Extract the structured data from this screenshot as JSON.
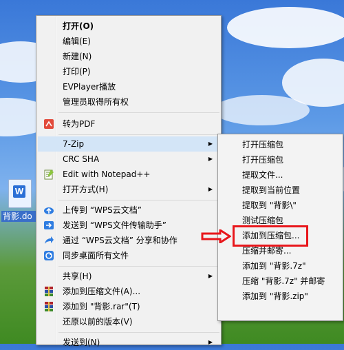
{
  "desktop": {
    "file_icon_label": "背影.do",
    "file_icon_glyph": "W"
  },
  "context_menu": {
    "items": [
      {
        "label": "打开(O)"
      },
      {
        "label": "编辑(E)"
      },
      {
        "label": "新建(N)"
      },
      {
        "label": "打印(P)"
      },
      {
        "label": "EVPlayer播放"
      },
      {
        "label": "管理员取得所有权"
      },
      {
        "label": "转为PDF",
        "icon": "pdf-convert-icon"
      },
      {
        "label": "7-Zip",
        "submenu": true,
        "highlighted": true
      },
      {
        "label": "CRC SHA",
        "submenu": true
      },
      {
        "label": "Edit with Notepad++",
        "icon": "notepad-plus-plus-icon"
      },
      {
        "label": "打开方式(H)",
        "submenu": true
      },
      {
        "label": "上传到 “WPS云文档”",
        "icon": "cloud-upload-icon"
      },
      {
        "label": "发送到 “WPS文件传输助手”",
        "icon": "send-arrow-icon"
      },
      {
        "label": "通过 “WPS云文档” 分享和协作",
        "icon": "share-icon"
      },
      {
        "label": "同步桌面所有文件",
        "icon": "sync-icon"
      },
      {
        "label": "共享(H)",
        "submenu": true
      },
      {
        "label": "添加到压缩文件(A)...",
        "icon": "winrar-icon"
      },
      {
        "label": "添加到 \"背影.rar\"(T)",
        "icon": "winrar-icon"
      },
      {
        "label": "还原以前的版本(V)"
      },
      {
        "label": "发送到(N)",
        "submenu": true
      }
    ]
  },
  "submenu_7zip": {
    "items": [
      {
        "label": "打开压缩包"
      },
      {
        "label": "打开压缩包"
      },
      {
        "label": "提取文件..."
      },
      {
        "label": "提取到当前位置"
      },
      {
        "label": "提取到 \"背影\\\""
      },
      {
        "label": "测试压缩包"
      },
      {
        "label": "添加到压缩包...",
        "annotated": true
      },
      {
        "label": "压缩并邮寄..."
      },
      {
        "label": "添加到 \"背影.7z\""
      },
      {
        "label": "压缩 \"背影.7z\" 并邮寄"
      },
      {
        "label": "添加到 \"背影.zip\""
      }
    ]
  },
  "colors": {
    "highlight": "#d3e5f7",
    "annotation_red": "#e8161b"
  }
}
